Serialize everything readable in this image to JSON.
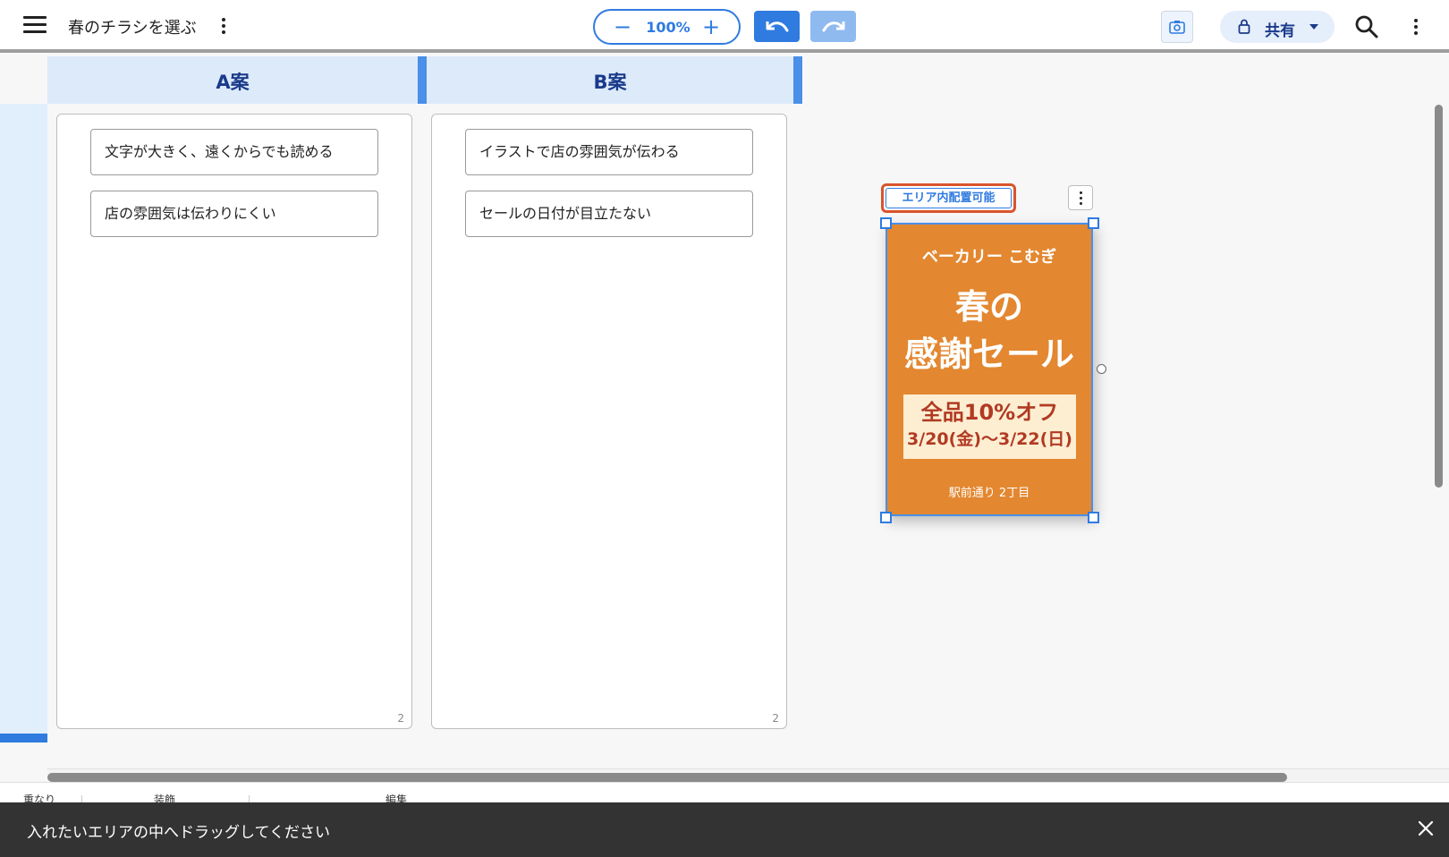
{
  "header": {
    "title": "春のチラシを選ぶ",
    "zoom": "100%",
    "zoom_minus": "−",
    "zoom_plus": "+",
    "share_label": "共有"
  },
  "areas": [
    {
      "label": "A案",
      "notes": [
        "文字が大きく、遠くからでも読める",
        "店の雰囲気は伝わりにくい"
      ],
      "count": "2"
    },
    {
      "label": "B案",
      "notes": [
        "イラストで店の雰囲気が伝わる",
        "セールの日付が目立たない"
      ],
      "count": "2"
    }
  ],
  "flyer": {
    "tag": "エリア内配置可能",
    "shop": "ベーカリー こむぎ",
    "headline_1": "春の",
    "headline_2": "感謝セール",
    "sale_1": "全品10%オフ",
    "sale_2": "3/20(金)〜3/22(日)",
    "address": "駅前通り 2丁目"
  },
  "bottom_tabs": [
    "重なり",
    "装飾",
    "編集"
  ],
  "snackbar": {
    "message": "入れたいエリアの中へドラッグしてください"
  },
  "colors": {
    "accent": "#2f7be0",
    "flyer_bg": "#e38730",
    "tag_border": "#d9542c",
    "area_header": "#ddeafa",
    "snackbar_bg": "#333333"
  }
}
